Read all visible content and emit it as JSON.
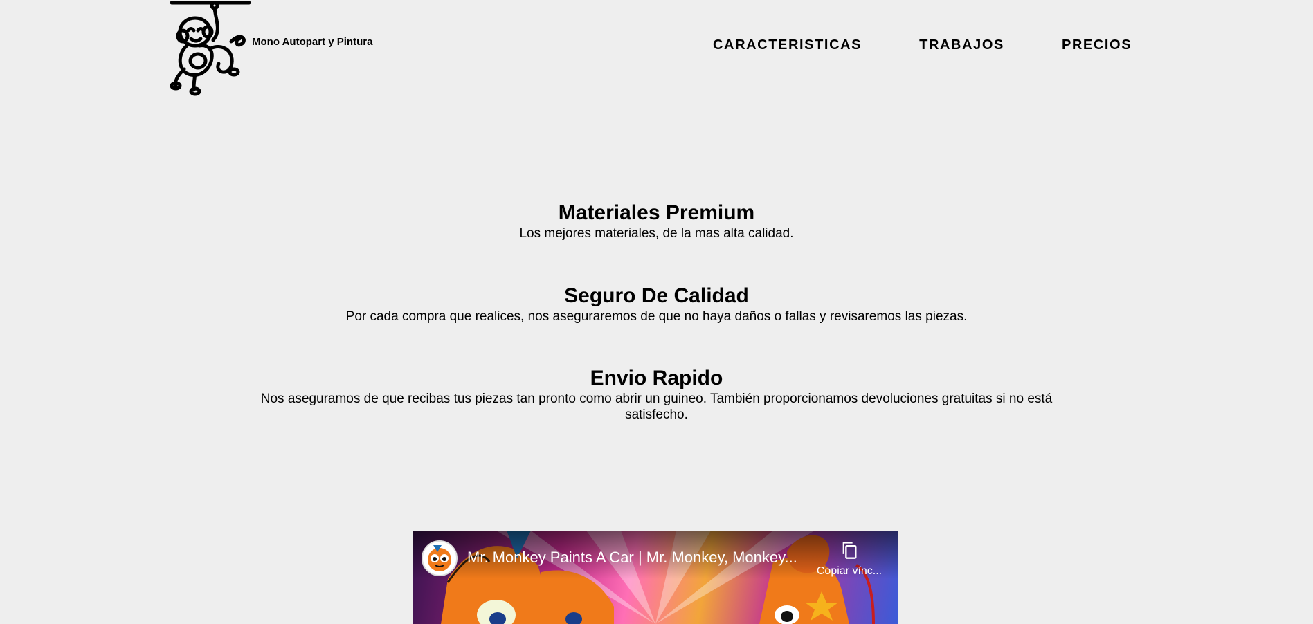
{
  "header": {
    "brand": "Mono Autopart y Pintura",
    "nav": [
      {
        "label": "CARACTERISTICAS"
      },
      {
        "label": "TRABAJOS"
      },
      {
        "label": "PRECIOS"
      }
    ]
  },
  "features": [
    {
      "title": "Materiales Premium",
      "description": "Los mejores materiales, de la mas alta calidad."
    },
    {
      "title": "Seguro De Calidad",
      "description": "Por cada compra que realices, nos aseguraremos de que no haya daños o fallas y revisaremos las piezas."
    },
    {
      "title": "Envio Rapido",
      "description": "Nos aseguramos de que recibas tus piezas tan pronto como abrir un guineo. También proporcionamos devoluciones gratuitas si no está satisfecho."
    }
  ],
  "video": {
    "title": "Mr. Monkey Paints A Car | Mr. Monkey, Monkey...",
    "copy_label": "Copiar vínc...",
    "icons": {
      "channel": "channel-avatar-icon",
      "copy": "copy-link-icon"
    }
  },
  "colors": {
    "background": "#eeeeee",
    "text": "#000000"
  }
}
